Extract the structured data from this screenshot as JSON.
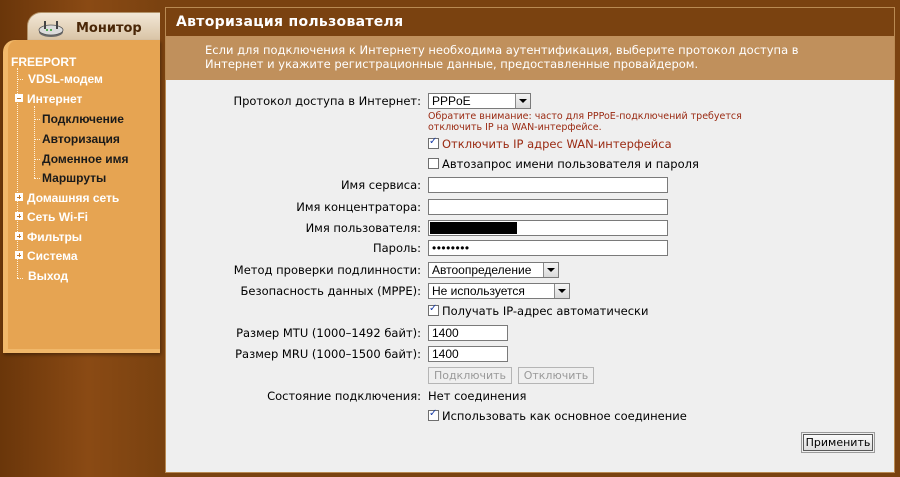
{
  "sidebar": {
    "tab_label": "Монитор",
    "icon": "router-icon",
    "items": {
      "freeport": "FREEPORT",
      "vdsl": "VDSL-модем",
      "internet": "Интернет",
      "connection": "Подключение",
      "authorization": "Авторизация",
      "domain": "Доменное имя",
      "routes": "Маршруты",
      "home_network": "Домашняя сеть",
      "wifi": "Сеть Wi-Fi",
      "filters": "Фильтры",
      "system": "Система",
      "exit": "Выход"
    }
  },
  "page": {
    "title": "Авторизация пользователя",
    "info_line1": "Если для подключения к Интернету необходима аутентификация, выберите протокол доступа в",
    "info_line2": "Интернет и укажите регистрационные данные, предоставленные провайдером."
  },
  "form": {
    "protocol_label": "Протокол доступа в Интернет:",
    "protocol_value": "PPPoE",
    "protocol_note1": "Обратите внимание: часто для PPPoE-подключений требуется",
    "protocol_note2": "отключить IP на WAN-интерфейсе.",
    "disable_ip_label": "Отключить IP адрес WAN-интерфейса",
    "auto_login_label": "Автозапрос имени пользователя и пароля",
    "service_label": "Имя сервиса:",
    "service_value": "",
    "concentrator_label": "Имя концентратора:",
    "concentrator_value": "",
    "username_label": "Имя пользователя:",
    "password_label": "Пароль:",
    "password_value": "••••••••",
    "auth_method_label": "Метод проверки подлинности:",
    "auth_method_value": "Автоопределение",
    "mppe_label": "Безопасность данных (MPPE):",
    "mppe_value": "Не используется",
    "auto_ip_label": "Получать IP-адрес автоматически",
    "mtu_label": "Размер MTU (1000–1492 байт):",
    "mtu_value": "1400",
    "mru_label": "Размер MRU (1000–1500 байт):",
    "mru_value": "1400",
    "connect_button": "Подключить",
    "disconnect_button": "Отключить",
    "status_label": "Состояние подключения:",
    "status_value": "Нет соединения",
    "primary_label": "Использовать как основное соединение",
    "apply_button": "Применить"
  },
  "state": {
    "disable_ip_checked": true,
    "auto_login_checked": false,
    "auto_ip_checked": true,
    "primary_checked": true
  },
  "colors": {
    "brand_brown": "#7a4210",
    "menu_orange": "#e6a452",
    "info_bar": "#c0905c",
    "note_red": "#9a2a12"
  }
}
